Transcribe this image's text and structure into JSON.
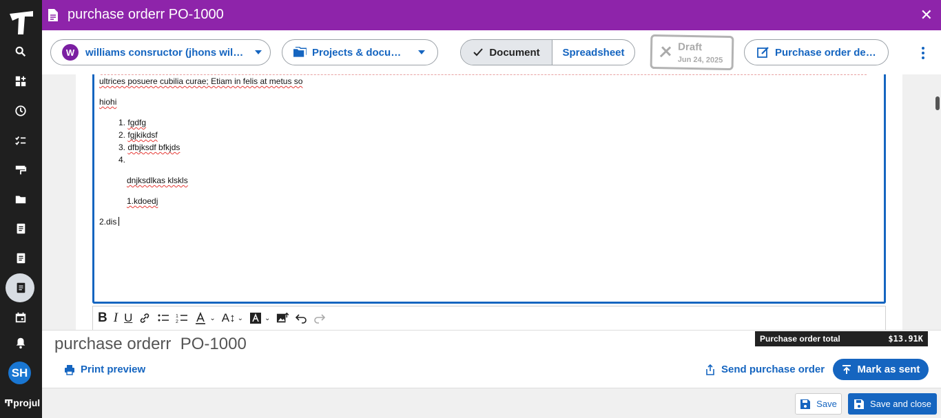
{
  "window": {
    "title": "purchase orderr PO-1000"
  },
  "sidebar": {
    "avatar_initials": "SH",
    "brand": "projul"
  },
  "toolbar": {
    "client_badge": "W",
    "client_label": "williams consructor (jhons williams)",
    "projects_label": "Projects & documents",
    "view_document": "Document",
    "view_spreadsheet": "Spreadsheet",
    "status": "Draft",
    "status_date": "Jun 24, 2025",
    "po_details_label": "Purchase order details"
  },
  "editor": {
    "line1": "ultrices posuere cubilia curae; Etiam in felis at metus so",
    "line2": "hiohi",
    "list": [
      {
        "num": "1.",
        "text": "fgdfg"
      },
      {
        "num": "2.",
        "text": "fgjkikdsf"
      },
      {
        "num": "3.",
        "text": "dfbjksdf bfkjds"
      },
      {
        "num": "4.",
        "text": ""
      }
    ],
    "sub1": "dnjksdlkas klskls",
    "sub2": "1.kdoedj",
    "line_last": "2.dis"
  },
  "bottom": {
    "po_name": "purchase orderr  PO-1000",
    "total_label": "Purchase order total",
    "total_value": "$13.91K",
    "print_preview": "Print preview",
    "send_po": "Send purchase order",
    "mark_sent": "Mark as sent"
  },
  "footer": {
    "save": "Save",
    "save_close": "Save and close"
  },
  "colors": {
    "title_bar": "#8e24aa",
    "accent": "#1565c0",
    "sidebar": "#1f1f1f"
  }
}
